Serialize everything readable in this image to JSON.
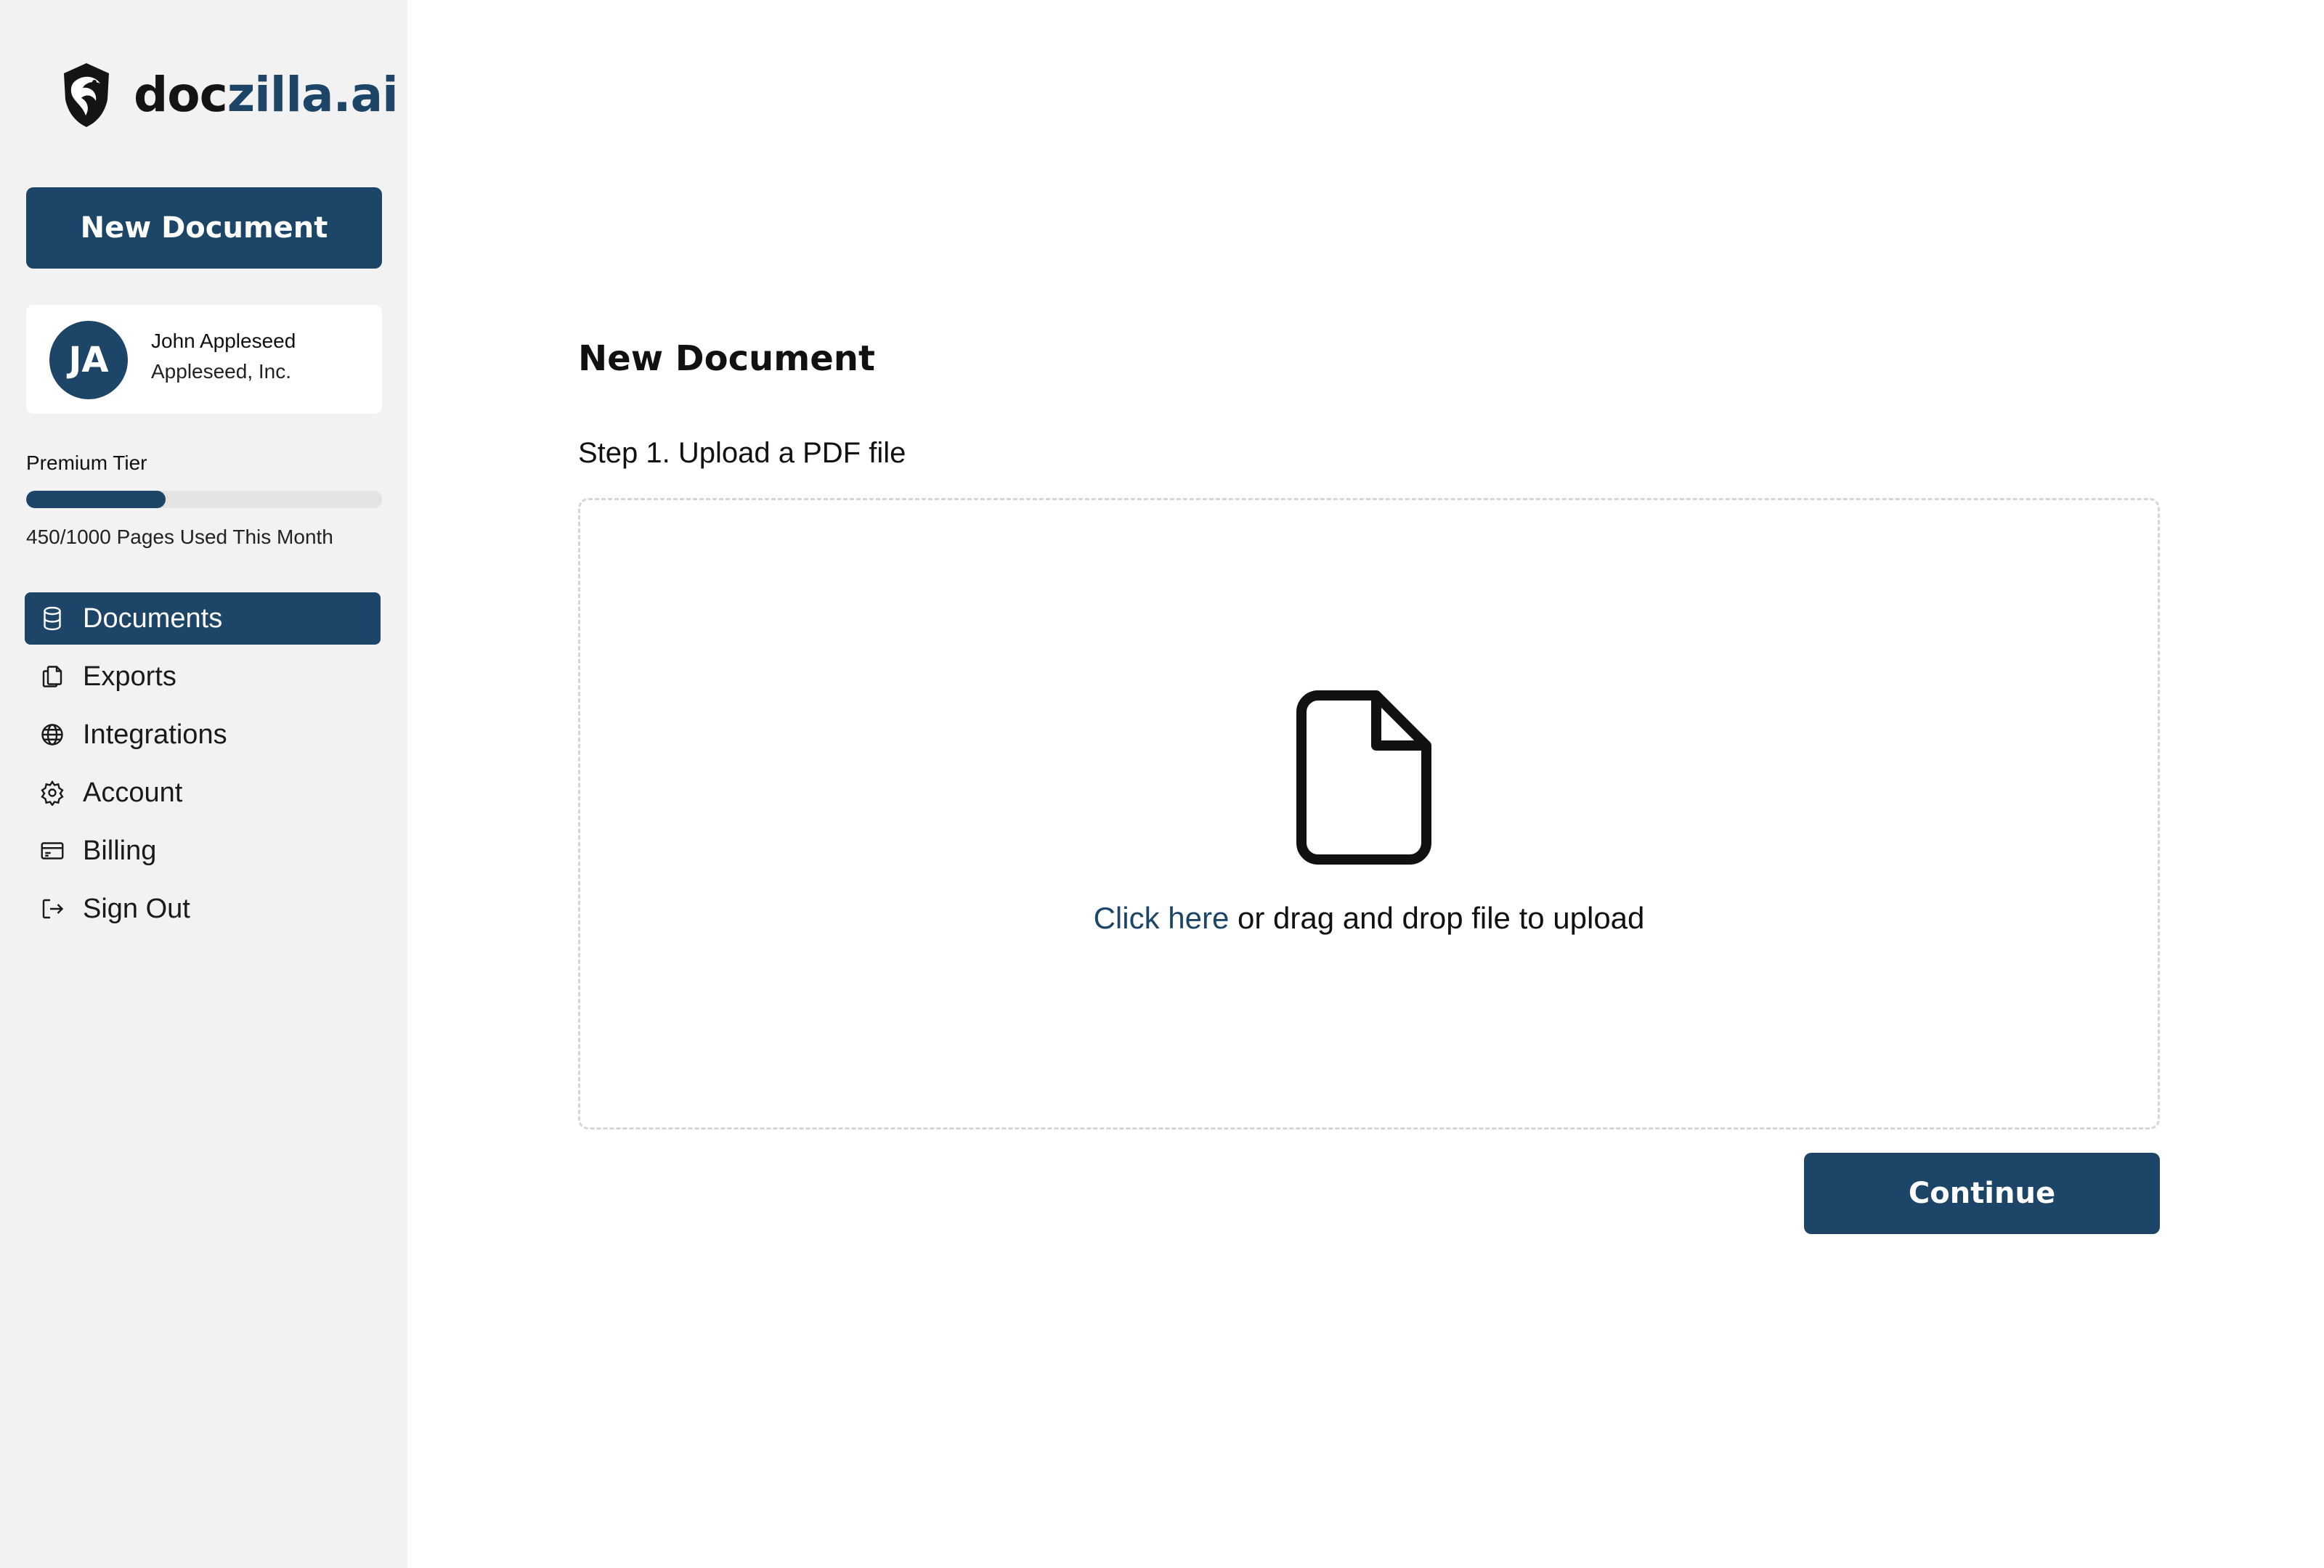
{
  "brand": {
    "name_part1": "doc",
    "name_part2": "zilla.ai",
    "accent_color": "#1d4567"
  },
  "sidebar": {
    "new_document_label": "New Document",
    "user": {
      "initials": "JA",
      "name": "John Appleseed",
      "company": "Appleseed, Inc."
    },
    "plan": {
      "tier": "Premium Tier",
      "usage_text": "450/1000 Pages Used This Month",
      "pages_used": 450,
      "pages_limit": 1000
    },
    "nav": [
      {
        "label": "Documents",
        "icon": "database-icon",
        "active": true
      },
      {
        "label": "Exports",
        "icon": "copy-icon",
        "active": false
      },
      {
        "label": "Integrations",
        "icon": "globe-icon",
        "active": false
      },
      {
        "label": "Account",
        "icon": "gear-icon",
        "active": false
      },
      {
        "label": "Billing",
        "icon": "credit-card-icon",
        "active": false
      },
      {
        "label": "Sign Out",
        "icon": "sign-out-icon",
        "active": false
      }
    ]
  },
  "main": {
    "title": "New Document",
    "step_label": "Step 1. Upload a PDF file",
    "dropzone": {
      "link_text": "Click here",
      "text": " or drag and drop file to upload",
      "icon": "file-icon"
    },
    "continue_label": "Continue"
  }
}
